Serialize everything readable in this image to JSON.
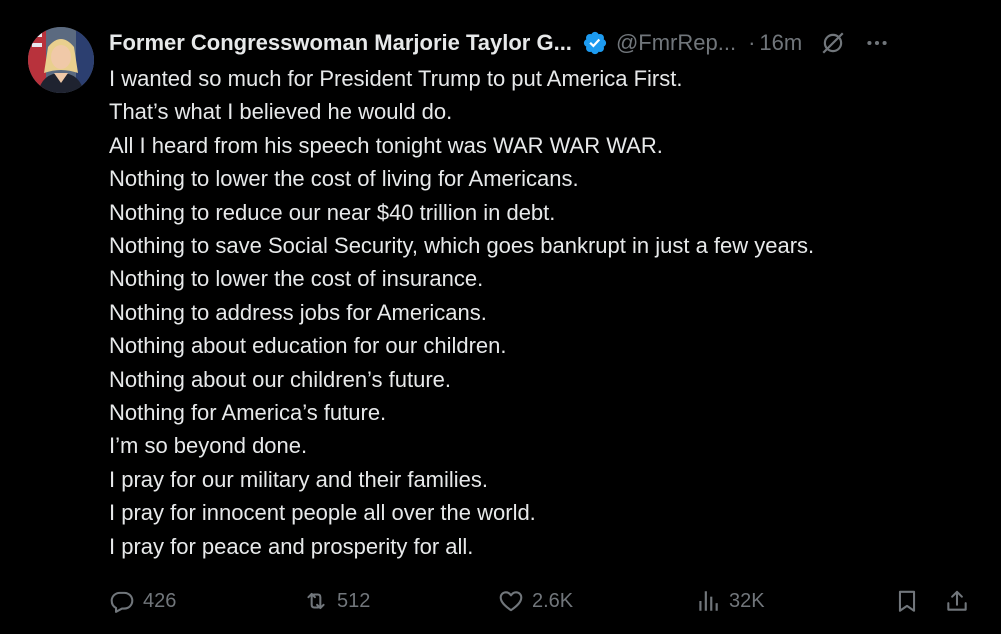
{
  "tweet": {
    "display_name": "Former Congresswoman Marjorie Taylor G...",
    "handle": "@FmrRep...",
    "separator": "·",
    "time": "16m",
    "lines": [
      "I wanted so much for President Trump to put America First.",
      "That’s what I believed he would do.",
      "All I heard from his speech tonight was WAR WAR WAR.",
      "Nothing to lower the cost of living for Americans.",
      "Nothing to reduce our near $40 trillion in debt.",
      "Nothing to save Social Security, which goes bankrupt in just a few years.",
      "Nothing to lower the cost of insurance.",
      "Nothing to address jobs for Americans.",
      "Nothing about education for our children.",
      "Nothing about our children’s future.",
      "Nothing for America’s future.",
      "I’m so beyond done.",
      "I pray for our military and their families.",
      "I pray for innocent people all over the world.",
      "I pray for peace and prosperity for all."
    ],
    "actions": {
      "replies": "426",
      "reposts": "512",
      "likes": "2.6K",
      "views": "32K"
    }
  },
  "colors": {
    "background": "#000000",
    "text": "#e7e9ea",
    "muted": "#71767b",
    "verified": "#1d9bf0"
  },
  "icons": {
    "verified": "verified-badge-icon",
    "grok": "grok-icon",
    "more": "more-icon",
    "reply": "reply-icon",
    "repost": "repost-icon",
    "like": "heart-icon",
    "views": "views-icon",
    "bookmark": "bookmark-icon",
    "share": "share-icon"
  }
}
